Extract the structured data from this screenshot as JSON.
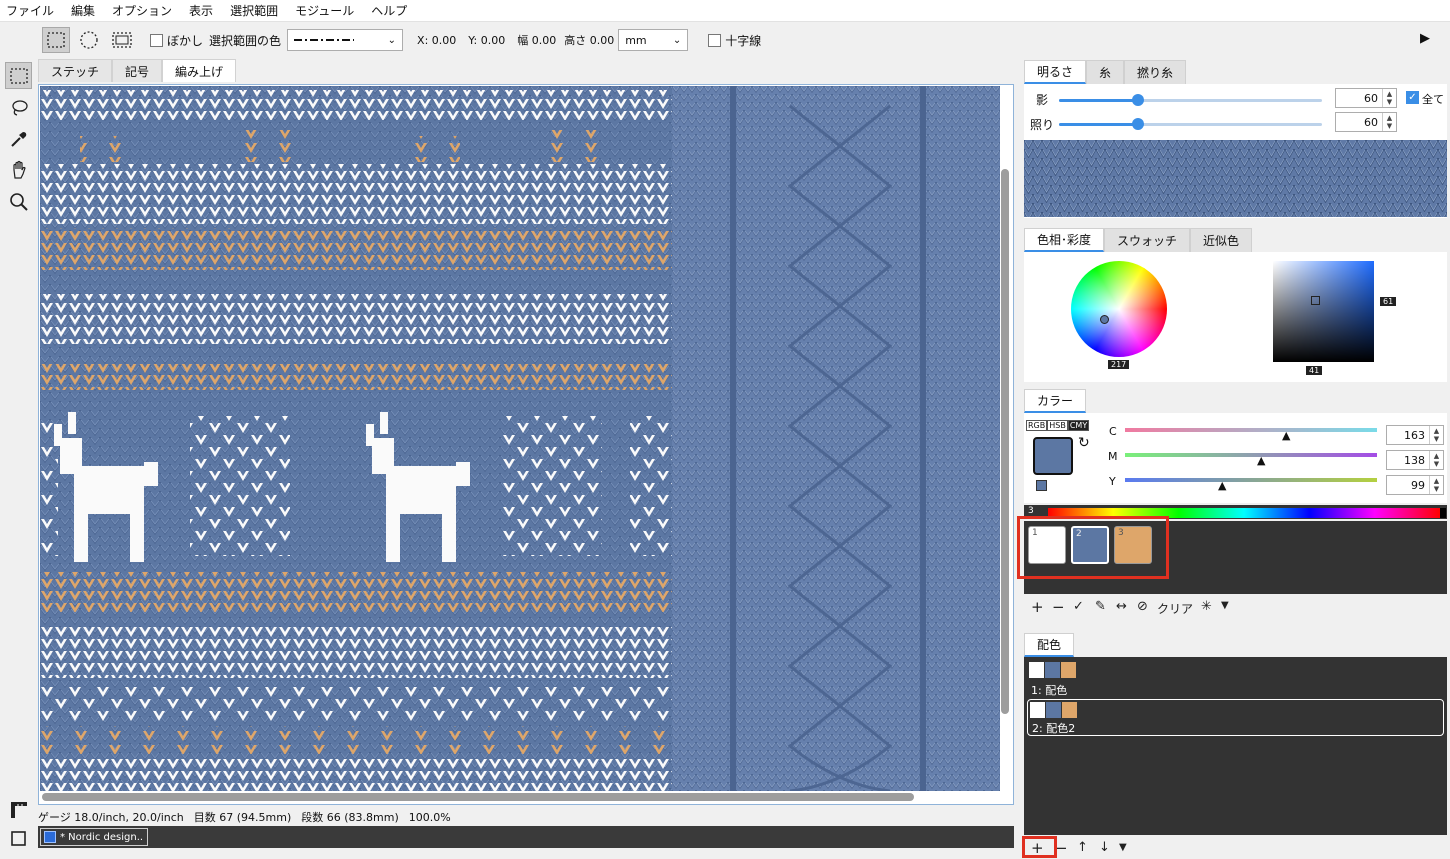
{
  "menu": [
    "ファイル",
    "編集",
    "オプション",
    "表示",
    "選択範囲",
    "モジュール",
    "ヘルプ"
  ],
  "toolbar": {
    "blur_label": "ぼかし",
    "selection_color_label": "選択範囲の色",
    "x_label": "X: 0.00",
    "y_label": "Y: 0.00",
    "width_label": "幅 0.00",
    "height_label": "高さ 0.00",
    "unit": "mm",
    "crosshair_label": "十字線"
  },
  "canvas_tabs": [
    "ステッチ",
    "記号",
    "編み上げ"
  ],
  "canvas_active_tab": 2,
  "status": {
    "gauge": "ゲージ 18.0/inch, 20.0/inch",
    "stitches": "目数 67 (94.5mm)",
    "rows": "段数 66 (83.8mm)",
    "zoom": "100.0%"
  },
  "document_tab": "* Nordic design..",
  "brightness_panel": {
    "tabs": [
      "明るさ",
      "糸",
      "撚り糸"
    ],
    "shadow_label": "影",
    "shadow_value": "60",
    "highlight_label": "照り",
    "highlight_value": "60",
    "all_label": "全て",
    "slider_fraction": 0.3
  },
  "color_picker": {
    "tabs": [
      "色相･彩度",
      "スウォッチ",
      "近似色"
    ],
    "hue_value": "217",
    "value_value": "61",
    "saturation_value": "41"
  },
  "color_panel": {
    "tab": "カラー",
    "modes": [
      "RGB",
      "HSB",
      "CMY"
    ],
    "active_mode": "CMY",
    "c_label": "C",
    "c_value": "163",
    "m_label": "M",
    "m_value": "138",
    "y_label": "Y",
    "y_value": "99",
    "spectrum_index": "3"
  },
  "colors": {
    "white": "#ffffff",
    "blue": "#5c77a3",
    "tan": "#dea66a",
    "accent": "#3a8ee6",
    "highlight_red": "#e03020"
  },
  "chips": [
    {
      "num": "1",
      "color": "#ffffff"
    },
    {
      "num": "2",
      "color": "#5c77a3"
    },
    {
      "num": "3",
      "color": "#dea66a"
    }
  ],
  "chip_tools": {
    "clear_label": "クリア"
  },
  "palette_panel": {
    "tab": "配色",
    "items": [
      {
        "label": "1: 配色"
      },
      {
        "label": "2: 配色2"
      }
    ]
  }
}
